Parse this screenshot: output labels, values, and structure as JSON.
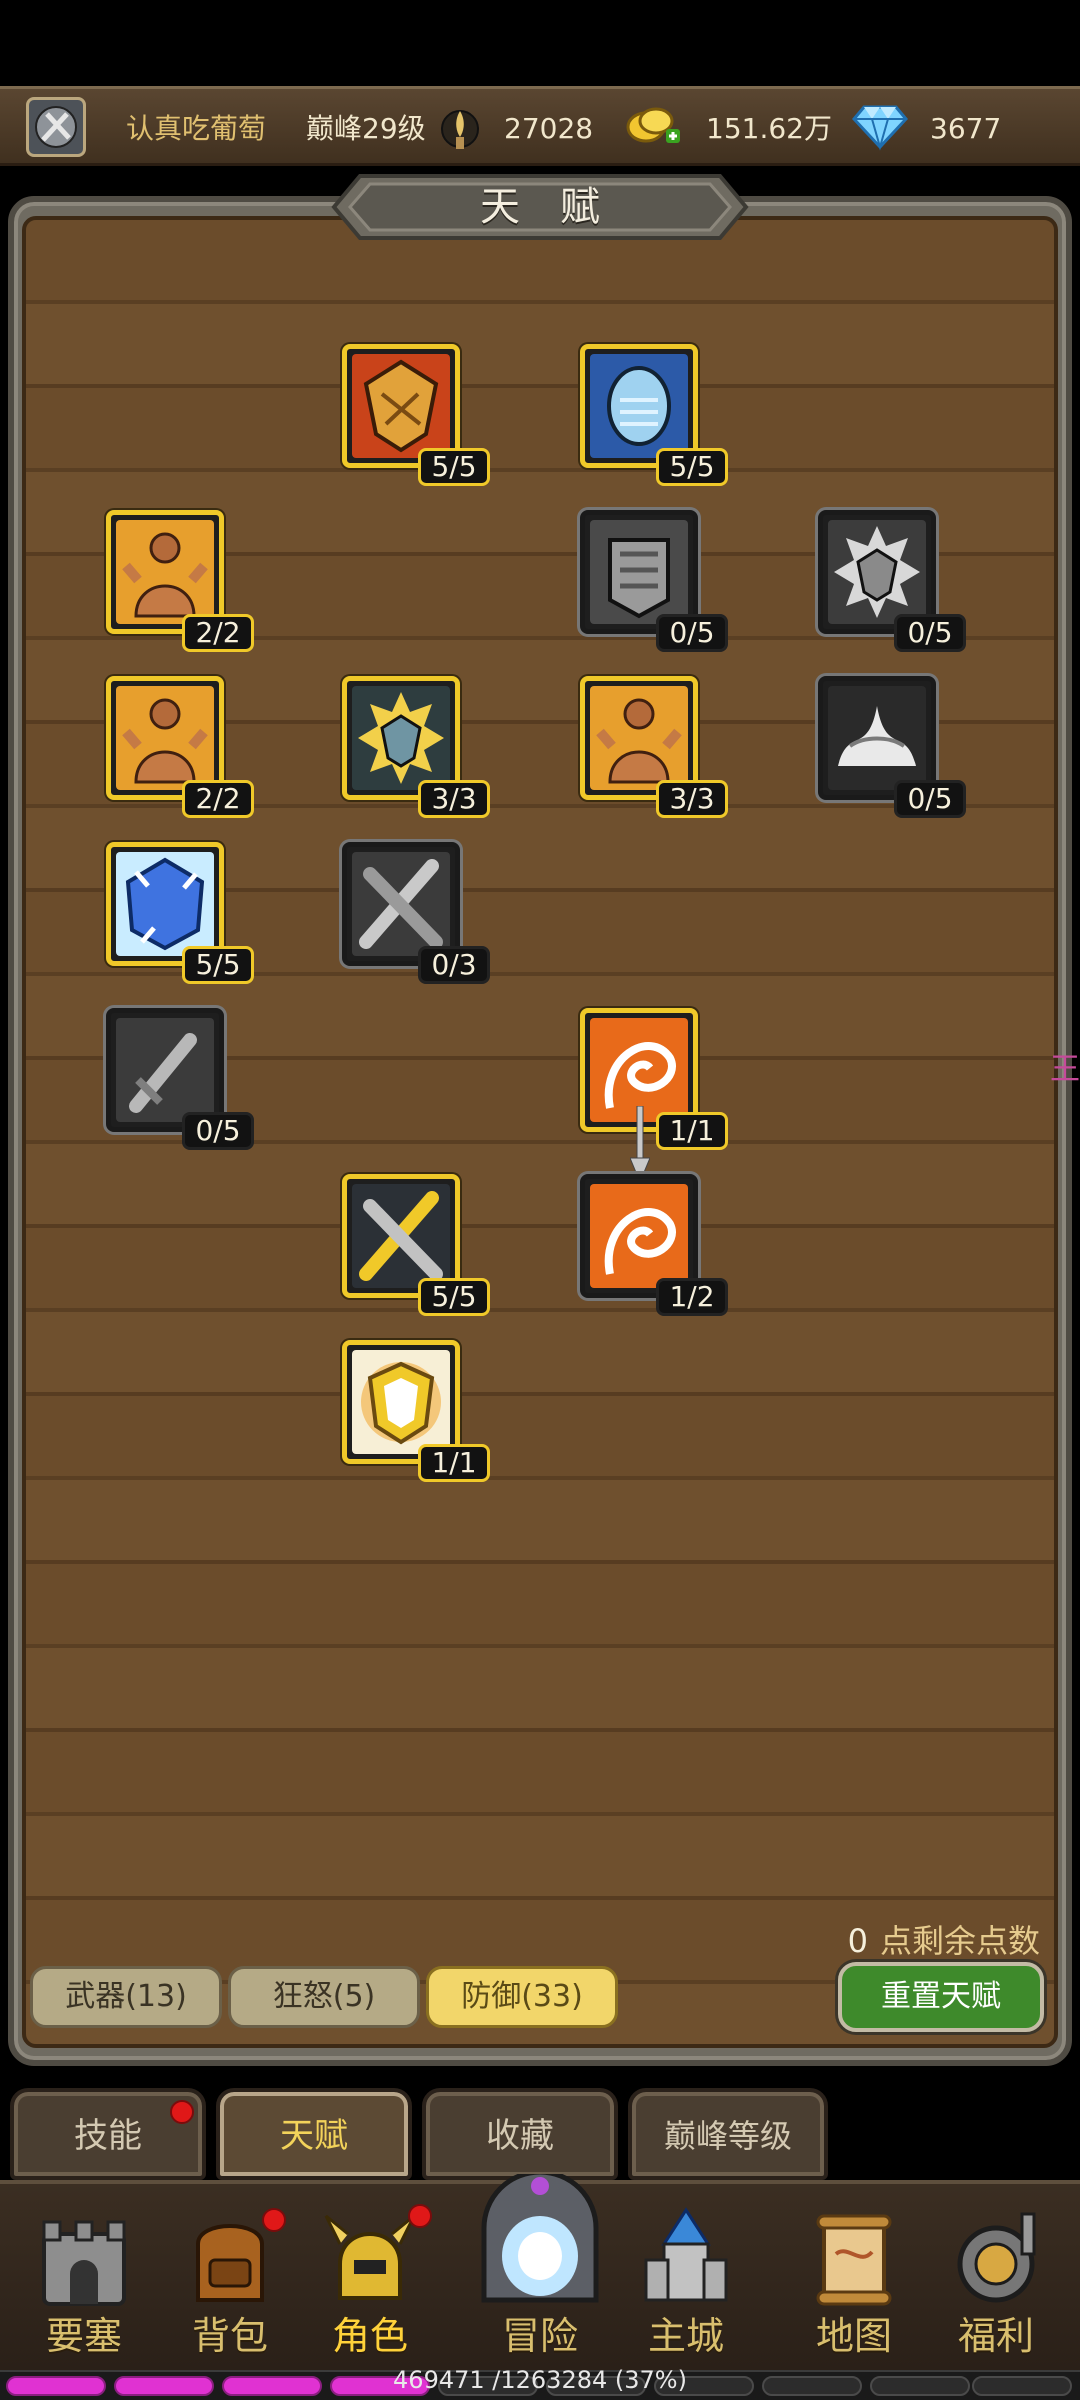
{
  "topbar": {
    "player_name": "认真吃葡萄",
    "peak_level": "巅峰29级",
    "currency_1": "27028",
    "currency_2": "151.62万",
    "diamonds": "3677"
  },
  "panel": {
    "title": "天赋"
  },
  "talents": [
    {
      "level": "5/5",
      "state": "unlocked",
      "icon": "shield-icon"
    },
    {
      "level": "5/5",
      "state": "unlocked",
      "icon": "armored-face-icon"
    },
    {
      "level": "2/2",
      "state": "unlocked",
      "icon": "muscle-man-icon"
    },
    {
      "level": "0/5",
      "state": "locked",
      "icon": "armor-plate-icon"
    },
    {
      "level": "0/5",
      "state": "locked",
      "icon": "spiked-shield-icon"
    },
    {
      "level": "2/2",
      "state": "unlocked",
      "icon": "muscle-man-icon"
    },
    {
      "level": "3/3",
      "state": "unlocked",
      "icon": "spiked-shield-icon"
    },
    {
      "level": "3/3",
      "state": "unlocked",
      "icon": "muscle-man-icon"
    },
    {
      "level": "0/5",
      "state": "locked",
      "icon": "white-burst-icon"
    },
    {
      "level": "5/5",
      "state": "unlocked",
      "icon": "ice-crystal-icon"
    },
    {
      "level": "0/3",
      "state": "locked",
      "icon": "crossed-swords-icon"
    },
    {
      "level": "0/5",
      "state": "locked",
      "icon": "sword-icon"
    },
    {
      "level": "1/1",
      "state": "unlocked",
      "icon": "vortex-icon"
    },
    {
      "level": "5/5",
      "state": "unlocked",
      "icon": "crossed-swords-icon"
    },
    {
      "level": "1/2",
      "state": "gray-frame",
      "icon": "vortex-icon"
    },
    {
      "level": "1/1",
      "state": "unlocked",
      "icon": "holy-shield-icon"
    }
  ],
  "points": {
    "value": "0",
    "label": "点剩余点数"
  },
  "categories": [
    {
      "label": "武器(13)",
      "active": false
    },
    {
      "label": "狂怒(5)",
      "active": false
    },
    {
      "label": "防御(33)",
      "active": true
    }
  ],
  "reset_button": "重置天赋",
  "subtabs": [
    {
      "label": "技能",
      "active": false
    },
    {
      "label": "天赋",
      "active": true
    },
    {
      "label": "收藏",
      "active": false
    },
    {
      "label": "巅峰等级",
      "active": false
    }
  ],
  "nav": [
    {
      "label": "要塞",
      "icon": "fortress-icon"
    },
    {
      "label": "背包",
      "icon": "backpack-icon"
    },
    {
      "label": "角色",
      "icon": "helmet-icon"
    },
    {
      "label": "冒险",
      "icon": "portal-icon"
    },
    {
      "label": "主城",
      "icon": "castle-icon"
    },
    {
      "label": "地图",
      "icon": "scroll-map-icon"
    },
    {
      "label": "福利",
      "icon": "gift-icon"
    }
  ],
  "xp": {
    "text": "469471 /1263284 (37%)",
    "fraction": 0.37
  },
  "colors": {
    "gold": "#f0c929",
    "wood": "#6b4c2b",
    "xp": "#e032d2",
    "reset_green": "#3e8a2b"
  }
}
